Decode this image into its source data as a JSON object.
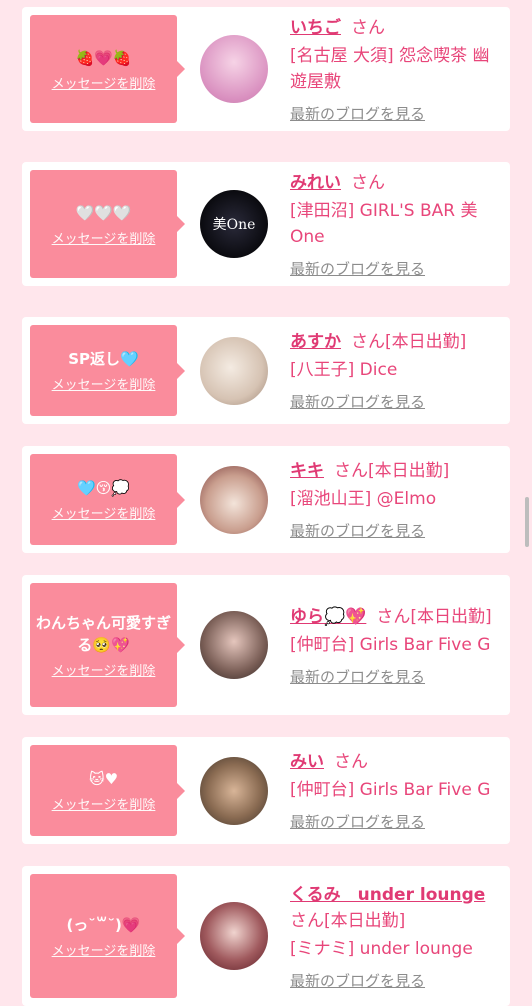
{
  "delete_label": "メッセージを削除",
  "blog_label": "最新のブログを見る",
  "san_label": "さん",
  "items": [
    {
      "message": "🍓💗🍓",
      "name": "いちご",
      "suffix": "",
      "area": "[名古屋 大須] 怨念喫茶 幽遊屋敷",
      "avatar_color": "#e7b9d9"
    },
    {
      "message": "🤍🤍🤍",
      "name": "みれい",
      "suffix": "",
      "area": "[津田沼] GIRL'S BAR 美One",
      "avatar_color": "#101018"
    },
    {
      "message": "SP返し🩵",
      "name": "あすか",
      "suffix": "[本日出勤]",
      "area": "[八王子] Dice",
      "avatar_color": "#e9dfd5"
    },
    {
      "message": "🩵😚💭",
      "name": "キキ",
      "suffix": "[本日出勤]",
      "area": "[溜池山王] @Elmo",
      "avatar_color": "#d8b7a5"
    },
    {
      "message": "わんちゃん可愛すぎる🥺💖",
      "name": "ゆら💭💖",
      "suffix": "[本日出勤]",
      "area": "[仲町台] Girls Bar Five G",
      "avatar_color": "#4d3f3b"
    },
    {
      "message": "🐱♥",
      "name": "みい",
      "suffix": "",
      "area": "[仲町台] Girls Bar Five G",
      "avatar_color": "#6d5a46"
    },
    {
      "message": "(っ˘꒳˘)💗",
      "name": "くるみ　under lounge",
      "suffix": "[本日出勤]",
      "area": "[ミナミ] under lounge",
      "avatar_color": "#7a2f35"
    }
  ],
  "avatar_label_1": "美One"
}
